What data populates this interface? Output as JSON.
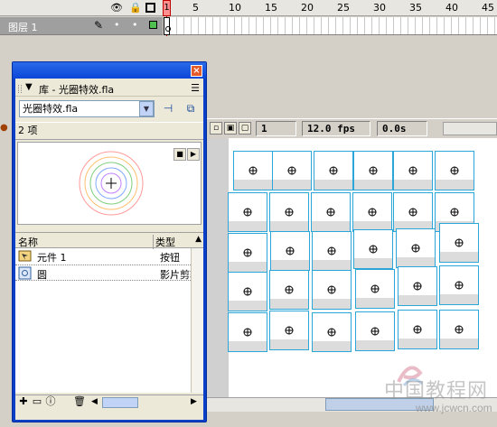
{
  "timeline": {
    "frame_numbers": [
      "1",
      "5",
      "10",
      "15",
      "20",
      "25",
      "30",
      "35",
      "40",
      "45"
    ],
    "eye_icon": "eye-icon",
    "lock_icon": "lock-icon",
    "outline_icon": "outline-icon",
    "playhead_frame": "1",
    "layer": {
      "name": "图层 1",
      "dot1": "•",
      "dot2": "•",
      "color": "#4fbf4f"
    }
  },
  "status_bar": {
    "current_frame": "1",
    "frame_rate": "12.0 fps",
    "elapsed_time": "0.0s"
  },
  "library": {
    "title": "库 - 光圈特效.fla",
    "document_select": "光圈特效.fla",
    "item_count": "2 项",
    "columns": {
      "name": "名称",
      "type": "类型"
    },
    "items": [
      {
        "name": "元件 1",
        "type": "按钮",
        "icon": "button-symbol-icon"
      },
      {
        "name": "圆",
        "type": "影片剪辑",
        "icon": "movieclip-symbol-icon"
      }
    ],
    "preview_colors": [
      "#ff7070",
      "#ffb050",
      "#70d070",
      "#70a0ff",
      "#b070ff"
    ]
  },
  "stage": {
    "instance_rows": 5,
    "instance_cols": 6,
    "accent": "#2aa7d8"
  },
  "watermark": {
    "text": "中国教程网",
    "url": "www.jcwcn.com"
  }
}
